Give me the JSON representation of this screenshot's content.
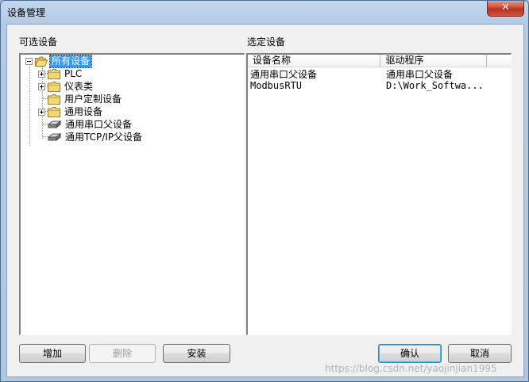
{
  "window": {
    "title": "设备管理"
  },
  "left_panel": {
    "label": "可选设备",
    "tree": [
      {
        "label": "所有设备",
        "icon": "folder-icon",
        "expanded": true,
        "selected": true
      },
      {
        "label": "PLC",
        "icon": "folder-icon",
        "expandable": true
      },
      {
        "label": "仪表类",
        "icon": "folder-icon",
        "expandable": true
      },
      {
        "label": "用户定制设备",
        "icon": "folder-icon"
      },
      {
        "label": "通用设备",
        "icon": "folder-icon",
        "expandable": true
      },
      {
        "label": "通用串口父设备",
        "icon": "device-icon"
      },
      {
        "label": "通用TCP/IP父设备",
        "icon": "device-icon"
      }
    ]
  },
  "right_panel": {
    "label": "选定设备",
    "columns": [
      "设备名称",
      "驱动程序"
    ],
    "rows": [
      [
        "通用串口父设备",
        "通用串口父设备"
      ],
      [
        "ModbusRTU",
        "D:\\Work_Softwa..."
      ]
    ]
  },
  "buttons": {
    "add": "增加",
    "delete": "删除",
    "install": "安装",
    "confirm": "确认",
    "cancel": "取消"
  },
  "watermark": "https://blog.csdn.net/yaojinjian1995",
  "colors": {
    "selection": "#3399ff",
    "close_button": "#c7432f",
    "frame": "#aec6e2"
  }
}
